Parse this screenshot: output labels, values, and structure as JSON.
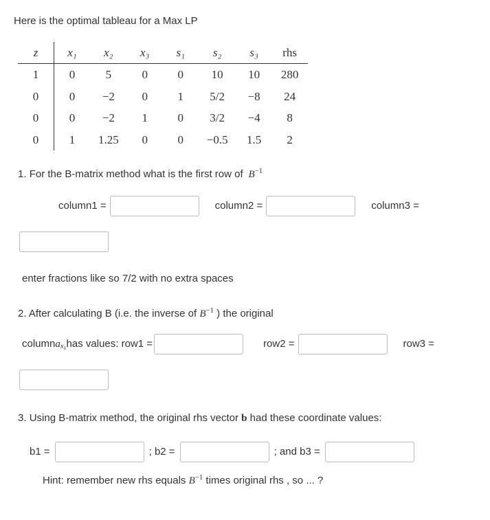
{
  "intro": "Here is the optimal tableau for a Max LP",
  "tableau": {
    "headers": [
      "z",
      "x₁",
      "x₂",
      "x₃",
      "s₁",
      "s₂",
      "s₃",
      "rhs"
    ],
    "rows": [
      [
        "1",
        "0",
        "5",
        "0",
        "0",
        "10",
        "10",
        "280"
      ],
      [
        "0",
        "0",
        "−2",
        "0",
        "1",
        "5/2",
        "−8",
        "24"
      ],
      [
        "0",
        "0",
        "−2",
        "1",
        "0",
        "3/2",
        "−4",
        "8"
      ],
      [
        "0",
        "1",
        "1.25",
        "0",
        "0",
        "−0.5",
        "1.5",
        "2"
      ]
    ]
  },
  "q1": {
    "num": "1.",
    "prompt_before": "For the B-matrix method what is the first row of ",
    "prompt_math": "B⁻¹",
    "col1": "column1 =",
    "col2": "column2 =",
    "col3": "column3 ="
  },
  "frac_hint_before": "enter fractions like so  7/2    with no extra spaces",
  "q2": {
    "num": "2.",
    "prompt_a": "After calculating  B  (i.e. the inverse of ",
    "prompt_math": "B⁻¹",
    "prompt_b": " )  the original",
    "line2_a": "column   ",
    "line2_b": "   has values:   row1 =",
    "row2": "row2 =",
    "row3": "row3 =",
    "ax_var": "a",
    "ax_sub": "x",
    "ax_subsub": "1"
  },
  "q3": {
    "num": "3.",
    "prompt_a": "Using B-matrix method, the original rhs vector  ",
    "prompt_bold": "b",
    "prompt_b": "  had these coordinate values:",
    "b1": "b1 =",
    "b2": ";  b2 =",
    "b3": "; and b3 =",
    "hint_a": "Hint: remember   new rhs equals  ",
    "hint_math": "B⁻¹",
    "hint_b": "  times original rhs ,  so ... ?"
  }
}
